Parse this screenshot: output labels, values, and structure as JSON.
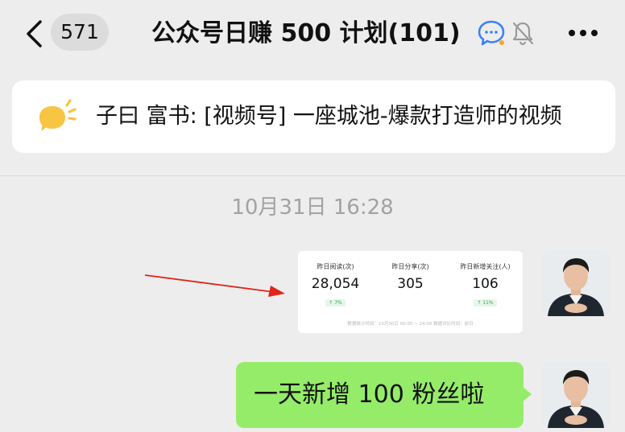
{
  "header": {
    "unread_count": "571",
    "title": "公众号日赚 500 计划(101)"
  },
  "pinned": {
    "text": "子曰 富书: [视频号] 一座城池-爆款打造师的视频"
  },
  "timestamp": "10月31日 16:28",
  "stats_image": {
    "items": [
      {
        "label": "昨日阅读(次)",
        "value": "28,054",
        "change": "↑ 7%"
      },
      {
        "label": "昨日分享(次)",
        "value": "305",
        "change": ""
      },
      {
        "label": "昨日新增关注(人)",
        "value": "106",
        "change": "↑ 11%"
      }
    ],
    "footer": "数据统计时间：10月30日 00:00 ~ 24:00 数据对比时间：前日"
  },
  "message": {
    "text": "一天新增 100 粉丝啦"
  },
  "colors": {
    "bubble": "#95ec69",
    "background": "#ededed",
    "accent_blue": "#3b82f6",
    "arrow": "#e0251b",
    "pin_icon": "#f7c542"
  }
}
